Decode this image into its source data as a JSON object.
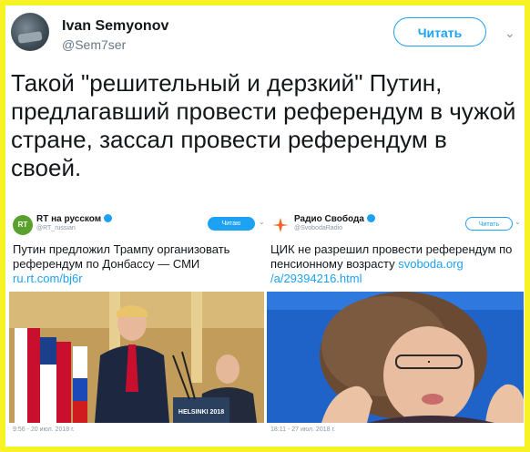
{
  "tweet": {
    "author_name": "Ivan Semyonov",
    "author_handle": "@Sem7ser",
    "follow_label": "Читать",
    "text": "Такой \"решительный и дерзкий\" Путин, предлагавший провести референдум в чужой стране, зассал провести референдум в своей."
  },
  "embedded": [
    {
      "name": "RT на русском",
      "handle": "@RT_russian",
      "logo_text": "RT",
      "follow_label": "Читаю",
      "text": "Путин предложил Трампу организовать референдум по Донбассу — СМИ",
      "link": "ru.rt.com/bj6r",
      "time": "9:56 - 20 июл. 2018 г.",
      "podium_text": "HELSINKI 2018"
    },
    {
      "name": "Радио Свобода",
      "handle": "@SvobodaRadio",
      "follow_label": "Читать",
      "text": "ЦИК не разрешил провести референдум по пенсионному возрасту",
      "link": "svoboda.org/a/29394216.html",
      "link_part1": "svoboda.org",
      "link_part2": "/a/29394216.html",
      "time": "18:11 - 27 июл. 2018 г."
    }
  ],
  "colors": {
    "frame": "#f7f224",
    "accent": "#1da1f2",
    "rt_green": "#5aa02c",
    "rs_orange": "#f26522"
  }
}
